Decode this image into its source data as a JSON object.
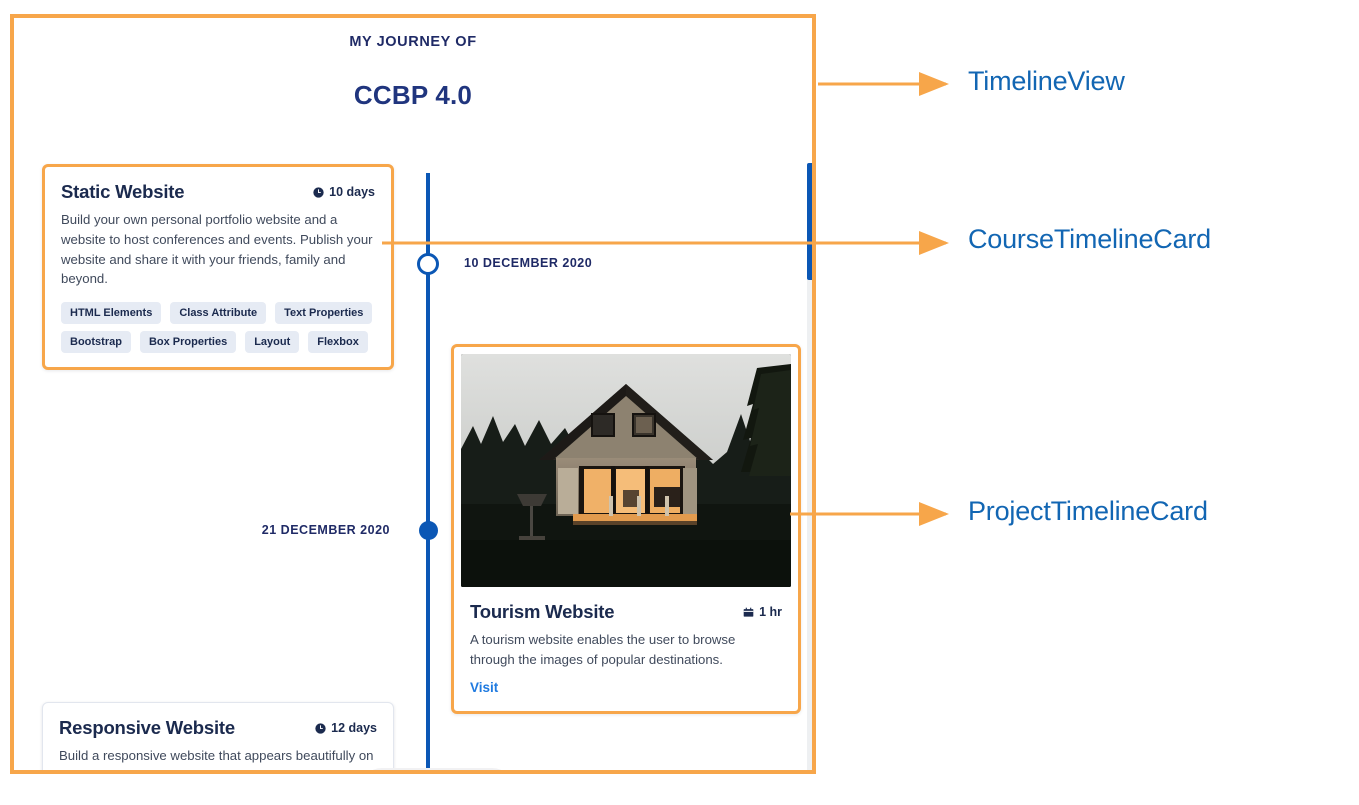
{
  "header": {
    "kicker": "MY JOURNEY OF",
    "title": "CCBP 4.0"
  },
  "timeline": {
    "dates": [
      {
        "id": "date-right",
        "text": "10 DECEMBER 2020"
      },
      {
        "id": "date-left",
        "text": "21 DECEMBER 2020"
      }
    ]
  },
  "cards": {
    "course1": {
      "title": "Static Website",
      "duration": "10 days",
      "duration_icon": "clock-icon",
      "description": "Build your own personal portfolio website and a website to host conferences and events. Publish your website and share it with your friends, family and beyond.",
      "tags": [
        "HTML Elements",
        "Class Attribute",
        "Text Properties",
        "Bootstrap",
        "Box Properties",
        "Layout",
        "Flexbox"
      ]
    },
    "project1": {
      "title": "Tourism Website",
      "duration": "1 hr",
      "duration_icon": "calendar-icon",
      "description": "A tourism website enables the user to browse through the images of popular destinations.",
      "link_label": "Visit",
      "image_alt": "dark forest cabin at dusk with lit windows"
    },
    "course2": {
      "title": "Responsive Website",
      "duration": "12 days",
      "duration_icon": "clock-icon",
      "description": "Build a responsive website that appears beautifully on"
    }
  },
  "nav_buttons": [
    {
      "name": "scroll-to-top-button",
      "icon": "double-chevron-up-icon",
      "style": "light"
    },
    {
      "name": "scroll-up-button",
      "icon": "chevron-up-icon",
      "style": "light"
    },
    {
      "name": "scroll-down-button",
      "icon": "chevron-down-icon",
      "style": "dark"
    },
    {
      "name": "scroll-to-bottom-button",
      "icon": "double-chevron-down-icon",
      "style": "dark"
    }
  ],
  "annotations": [
    {
      "label": "TimelineView"
    },
    {
      "label": "CourseTimelineCard"
    },
    {
      "label": "ProjectTimelineCard"
    }
  ],
  "colors": {
    "annotation_orange": "#f7a64a",
    "annotation_text_blue": "#1266b3",
    "timeline_blue": "#0b57b5",
    "title_navy": "#20357e",
    "tag_bg": "#e6ebf4",
    "link_blue": "#1f7ae0"
  }
}
